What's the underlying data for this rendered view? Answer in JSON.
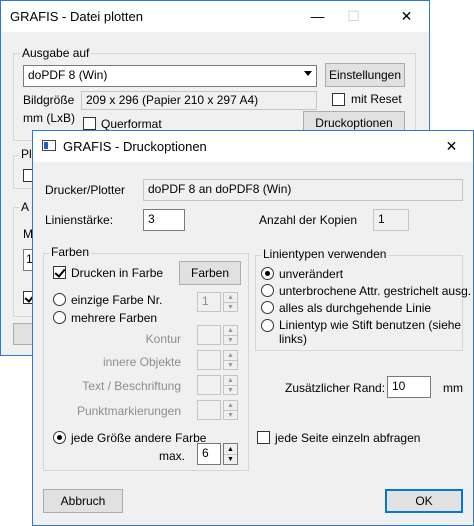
{
  "back_window": {
    "title": "GRAFIS - Datei plotten",
    "titlebar_buttons": {
      "minimize": "—",
      "maximize": "☐",
      "close": "✕"
    },
    "group_output": "Ausgabe auf",
    "printer_select": "doPDF 8 (Win)",
    "btn_settings": "Einstellungen",
    "label_size": "Bildgröße",
    "label_unit": "mm (LxB)",
    "size_value": "209 x 296 (Papier 210 x 297 A4)",
    "chk_reset": "mit Reset",
    "chk_landscape": "Querformat",
    "btn_print_options": "Druckoptionen",
    "partial_label_pl": "Pl",
    "partial_label_a": "A",
    "partial_label_m": "M",
    "partial_label_1": "1"
  },
  "dialog": {
    "title": "GRAFIS - Druckoptionen",
    "close": "✕",
    "label_printer": "Drucker/Plotter",
    "printer_value": "doPDF 8 an doPDF8 (Win)",
    "label_linewidth": "Linienstärke:",
    "linewidth_value": "3",
    "label_copies": "Anzahl der Kopien",
    "copies_value": "1",
    "group_colors": "Farben",
    "chk_print_color": "Drucken in Farbe",
    "btn_colors": "Farben",
    "radio_single_color": "einzige Farbe Nr.",
    "single_color_value": "1",
    "radio_multi_color": "mehrere Farben",
    "label_contour": "Kontur",
    "label_inner_objects": "innere Objekte",
    "label_text": "Text / Beschriftung",
    "label_points": "Punktmarkierungen",
    "radio_each_size": "jede Größe andere Farbe",
    "label_max": "max.",
    "max_value": "6",
    "group_linetypes": "Linientypen verwenden",
    "radio_unchanged": "unverändert",
    "radio_dashed": "unterbrochene Attr. gestrichelt ausg.",
    "radio_solid": "alles als durchgehende Linie",
    "radio_pen_line1": "Linientyp wie Stift benutzen (siehe",
    "radio_pen_line2": "links)",
    "label_margin": "Zusätzlicher Rand:",
    "margin_value": "10",
    "margin_unit": "mm",
    "chk_each_page": "jede Seite einzeln abfragen",
    "btn_cancel": "Abbruch",
    "btn_ok": "OK"
  },
  "colors": {
    "accent_border": "#2b79d0",
    "dialog_bg": "#f0f0f0"
  }
}
